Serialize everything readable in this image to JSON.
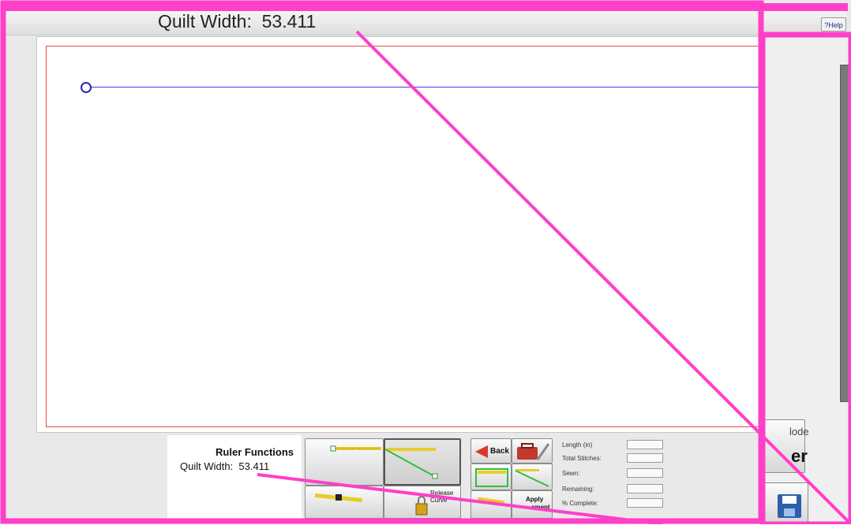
{
  "top_bar": {
    "quilt_width_callout": "Quilt Width:  53.411",
    "help_label": "?Help"
  },
  "ruler_functions": {
    "title": "Ruler Functions",
    "quilt_width": "Quilt Width:  53.411"
  },
  "toolbar": {
    "release_label": "Release",
    "release_label_2": "Curve",
    "back_label": "Back",
    "apply_label": "Apply",
    "apply_label_2": "ement"
  },
  "stats": {
    "length_label": "Length (in)",
    "total_stitches_label": "Total Stitches:",
    "sewn_label": "Sewn:",
    "remaining_label": "Remaining:",
    "percent_complete_label": "% Complete:",
    "length_value": "",
    "total_stitches_value": "",
    "sewn_value": "",
    "remaining_value": "",
    "percent_complete_value": ""
  },
  "right_window": {
    "mode_label_top": "lode",
    "mode_label_bottom": "er"
  },
  "colors": {
    "annotation": "#ff3fc8",
    "quilt_boundary": "#e24b4b",
    "ruler_line": "#3c3cf0",
    "ruler_green": "#2fbf3a",
    "ruler_yellow": "#e8cc2a"
  },
  "icons": [
    "help-icon",
    "ruler-icon",
    "back-arrow-icon",
    "toolbox-icon",
    "lock-icon",
    "save-icon"
  ]
}
